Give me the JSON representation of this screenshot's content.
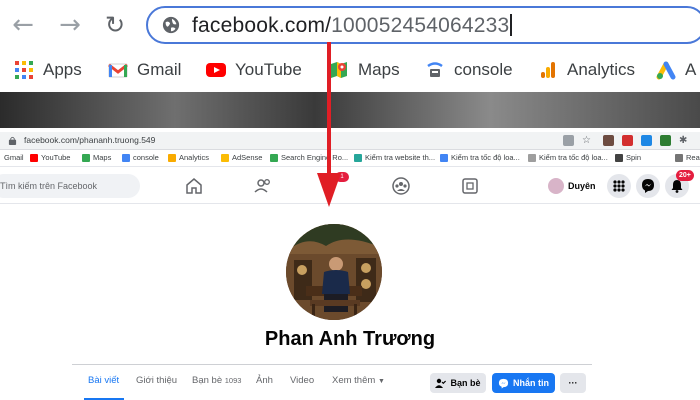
{
  "browser": {
    "address_domain": "facebook.com/",
    "address_path": "100052454064233",
    "bookmarks": [
      {
        "label": "Apps",
        "icon": "apps-grid-icon"
      },
      {
        "label": "Gmail",
        "icon": "gmail-icon"
      },
      {
        "label": "YouTube",
        "icon": "youtube-icon"
      },
      {
        "label": "Maps",
        "icon": "maps-icon"
      },
      {
        "label": "console",
        "icon": "console-icon"
      },
      {
        "label": "Analytics",
        "icon": "analytics-icon"
      },
      {
        "label": "A",
        "icon": "ads-icon"
      }
    ]
  },
  "inner_browser": {
    "url": "facebook.com/phananh.truong.549",
    "bookmarks": [
      "Gmail",
      "YouTube",
      "Maps",
      "console",
      "Analytics",
      "AdSense",
      "Search Engine Ro...",
      "Kiểm tra website th...",
      "Kiểm tra tốc độ loa...",
      "Kiểm tra tốc độ loa...",
      "Spin",
      "Rea"
    ]
  },
  "facebook": {
    "search_placeholder": "Tìm kiếm trên Facebook",
    "nav_badge": "1",
    "profile_chip_name": "Duyên",
    "notifications_badge": "20+",
    "profile": {
      "name": "Phan Anh Trương",
      "tabs": [
        {
          "label": "Bài viết",
          "active": true
        },
        {
          "label": "Giới thiệu",
          "active": false
        },
        {
          "label": "Bạn bè",
          "active": false,
          "count": "1093"
        },
        {
          "label": "Ảnh",
          "active": false
        },
        {
          "label": "Video",
          "active": false
        },
        {
          "label": "Xem thêm",
          "active": false
        }
      ],
      "friends_button": "Bạn bè",
      "message_button": "Nhắn tin",
      "more_button": "···"
    }
  },
  "colors": {
    "annotation_arrow": "#e01e25",
    "facebook_blue": "#1877f2",
    "omnibox_border": "#4a78d8"
  }
}
